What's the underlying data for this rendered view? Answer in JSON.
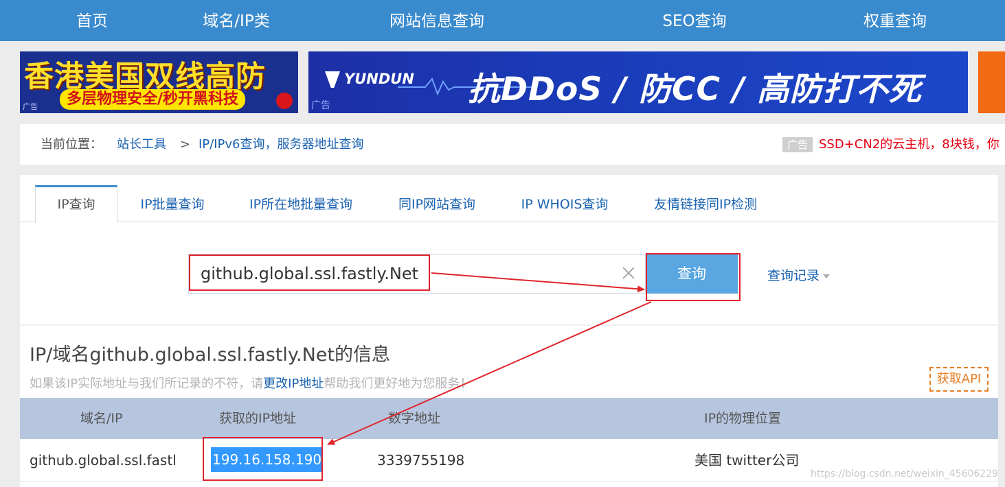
{
  "nav": {
    "items": [
      "首页",
      "域名/IP类",
      "网站信息查询",
      "SEO查询",
      "权重查询"
    ]
  },
  "ads": {
    "left": {
      "headline": "香港美国双线高防",
      "sub": "多层物理安全/秒开黑科技",
      "tag": "广告"
    },
    "center": {
      "logo": "YUNDUN",
      "slogan": "抗DDoS / 防CC / 高防打不死",
      "tag": "广告"
    }
  },
  "breadcrumb": {
    "label": "当前位置：",
    "link1": "站长工具",
    "sep": ">",
    "link2": "IP/IPv6查询，服务器地址查询",
    "ad_badge": "广告",
    "ad_text": "SSD+CN2的云主机，8块钱，你"
  },
  "tabs": [
    "IP查询",
    "IP批量查询",
    "IP所在地批量查询",
    "同IP网站查询",
    "IP WHOIS查询",
    "友情链接同IP检测"
  ],
  "search": {
    "value": "github.global.ssl.fastly.Net",
    "button": "查询",
    "history": "查询记录"
  },
  "info": {
    "title": "IP/域名github.global.ssl.fastly.Net的信息",
    "note_pre": "如果该IP实际地址与我们所记录的不符，请",
    "note_link": "更改IP地址",
    "note_post": "帮助我们更好地为您服务！",
    "api": "获取API"
  },
  "table": {
    "headers": [
      "域名/IP",
      "获取的IP地址",
      "数字地址",
      "IP的物理位置"
    ],
    "row": {
      "domain": "github.global.ssl.fastly.Net",
      "ip": "199.16.158.190",
      "numeric": "3339755198",
      "location": "美国 twitter公司"
    }
  },
  "watermark": "https://blog.csdn.net/weixin_45606229",
  "colors": {
    "nav": "#3a8bcd",
    "link": "#1a62b0",
    "button": "#59a6e0",
    "table_header": "#b7c6df",
    "highlight": "#3399ff",
    "annotation": "#e0242b",
    "api": "#e67e22"
  }
}
